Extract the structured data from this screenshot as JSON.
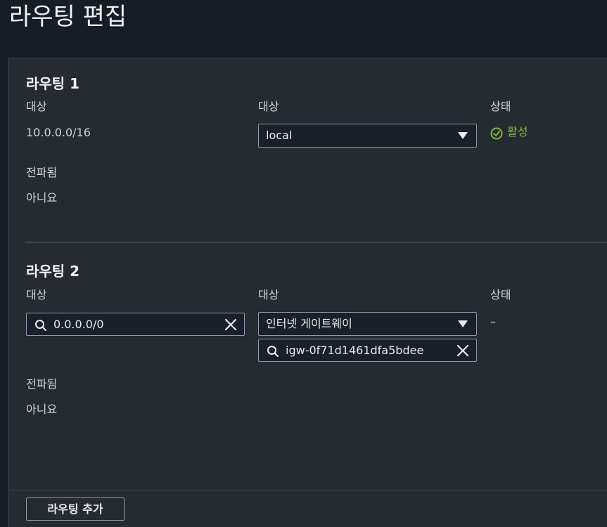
{
  "page": {
    "title": "라우팅 편집"
  },
  "routes": [
    {
      "title": "라우팅 1",
      "destination_label": "대상",
      "destination_value": "10.0.0.0/16",
      "target_label": "대상",
      "target_selected": "local",
      "status_label": "상태",
      "status_value": "활성",
      "propagated_label": "전파됨",
      "propagated_value": "아니요"
    },
    {
      "title": "라우팅 2",
      "destination_label": "대상",
      "destination_value": "0.0.0.0/0",
      "target_label": "대상",
      "target_selected": "인터넷 게이트웨이",
      "target_search_value": "igw-0f71d1461dfa5bdee",
      "status_label": "상태",
      "status_value": "–",
      "propagated_label": "전파됨",
      "propagated_value": "아니요"
    }
  ],
  "footer": {
    "add_route_label": "라우팅 추가"
  },
  "icons": {
    "status_active": "check-circle-icon",
    "dropdown": "caret-down-icon",
    "search": "search-icon",
    "clear": "close-icon"
  },
  "colors": {
    "status_active": "#7cbb3a",
    "background": "#161d26",
    "panel": "#262b32"
  }
}
